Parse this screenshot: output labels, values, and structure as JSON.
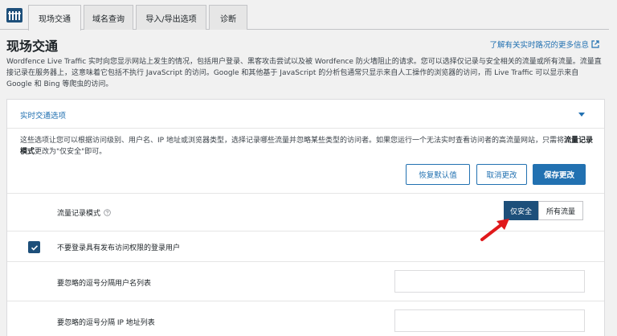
{
  "tabs": [
    {
      "label": "现场交通",
      "active": true
    },
    {
      "label": "域名查询",
      "active": false
    },
    {
      "label": "导入/导出选项",
      "active": false
    },
    {
      "label": "诊断",
      "active": false
    }
  ],
  "page": {
    "title": "现场交通",
    "help_link": "了解有关实时路况的更多信息",
    "description": "Wordfence Live Traffic 实时向您显示网站上发生的情况，包括用户登录、黑客攻击尝试以及被 Wordfence 防火墙阻止的请求。您可以选择仅记录与安全相关的流量或所有流量。流量直接记录在服务器上，这意味着它包括不执行 JavaScript 的访问。Google 和其他基于 JavaScript 的分析包通常只显示来自人工操作的浏览器的访问，而 Live Traffic 可以显示来自 Google 和 Bing 等爬虫的访问。"
  },
  "panel": {
    "title": "实时交通选项",
    "text_before": "这些选项让您可以根据访问级别、用户名、IP 地址或浏览器类型，选择记录哪些流量并忽略某些类型的访问者。如果您运行一个无法实时查看访问者的高流量网站，只需将",
    "text_bold": "流量记录模式",
    "text_after": "更改为\"仅安全\"即可。",
    "buttons": {
      "restore": "恢复默认值",
      "cancel": "取消更改",
      "save": "保存更改"
    }
  },
  "options": {
    "logging_mode_label": "流量记录模式",
    "logging_modes": [
      {
        "label": "仅安全",
        "active": true
      },
      {
        "label": "所有流量",
        "active": false
      }
    ],
    "ignore_publishers_label": "不要登录具有发布访问权限的登录用户",
    "ignore_publishers_checked": true,
    "usernames_label": "要忽略的逗号分隔用户名列表",
    "usernames_value": "",
    "ips_label": "要忽略的逗号分隔 IP 地址列表",
    "ips_value": ""
  },
  "colors": {
    "accent": "#2271b1",
    "active_segment": "#1d4f7a",
    "annotation_arrow": "#e0191b"
  }
}
